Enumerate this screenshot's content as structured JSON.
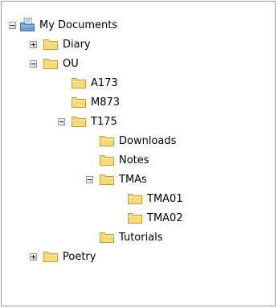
{
  "tree": {
    "root": {
      "label": "My Documents",
      "toggle": "minus",
      "icon": "my-documents-folder-icon"
    },
    "items": [
      {
        "label": "Diary",
        "toggle": "plus",
        "icon": "folder-icon"
      },
      {
        "label": "OU",
        "toggle": "minus",
        "icon": "folder-icon"
      },
      {
        "label": "A173",
        "toggle": "none",
        "icon": "folder-icon"
      },
      {
        "label": "M873",
        "toggle": "none",
        "icon": "folder-icon"
      },
      {
        "label": "T175",
        "toggle": "minus",
        "icon": "folder-icon"
      },
      {
        "label": "Downloads",
        "toggle": "none",
        "icon": "folder-icon"
      },
      {
        "label": "Notes",
        "toggle": "none",
        "icon": "folder-icon"
      },
      {
        "label": "TMAs",
        "toggle": "minus",
        "icon": "folder-icon"
      },
      {
        "label": "TMA01",
        "toggle": "none",
        "icon": "folder-icon"
      },
      {
        "label": "TMA02",
        "toggle": "none",
        "icon": "folder-icon"
      },
      {
        "label": "Tutorials",
        "toggle": "none",
        "icon": "folder-icon"
      },
      {
        "label": "Poetry",
        "toggle": "plus",
        "icon": "folder-icon"
      }
    ]
  },
  "colors": {
    "folder_fill": "#f6d979",
    "folder_border": "#c89c2a",
    "toggle_border": "#7f9db9"
  }
}
